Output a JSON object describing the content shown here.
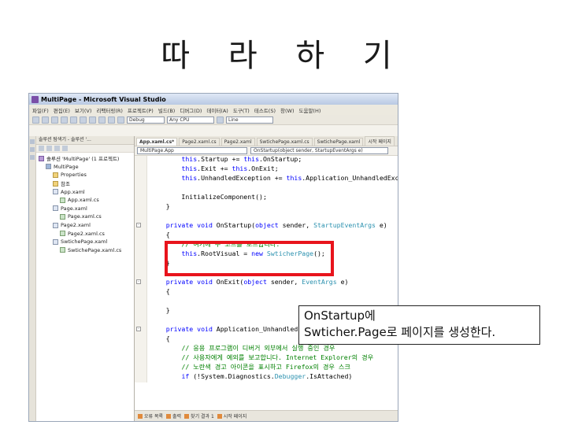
{
  "slide": {
    "title": "따 라 하 기"
  },
  "window": {
    "title": "MultiPage - Microsoft Visual Studio",
    "menu": [
      "파일(F)",
      "편집(E)",
      "보기(V)",
      "리팩터링(R)",
      "프로젝트(P)",
      "빌드(B)",
      "디버그(D)",
      "데이터(A)",
      "도구(T)",
      "테스트(S)",
      "창(W)",
      "도움말(H)"
    ],
    "toolbar": {
      "config": "Debug",
      "platform": "Any CPU",
      "find": "Line"
    }
  },
  "solution_explorer": {
    "header": "솔루션 탐색기 - 솔루션 '...",
    "items": [
      {
        "label": "솔루션 'MultiPage' (1 프로젝트)",
        "icon": "solution-icon",
        "indent": 0
      },
      {
        "label": "MultiPage",
        "icon": "project-icon",
        "indent": 1
      },
      {
        "label": "Properties",
        "icon": "folder-icon",
        "indent": 2
      },
      {
        "label": "참조",
        "icon": "folder-icon",
        "indent": 2
      },
      {
        "label": "App.xaml",
        "icon": "xaml-icon",
        "indent": 2
      },
      {
        "label": "App.xaml.cs",
        "icon": "cs-icon",
        "indent": 3
      },
      {
        "label": "Page.xaml",
        "icon": "xaml-icon",
        "indent": 2
      },
      {
        "label": "Page.xaml.cs",
        "icon": "cs-icon",
        "indent": 3
      },
      {
        "label": "Page2.xaml",
        "icon": "xaml-icon",
        "indent": 2
      },
      {
        "label": "Page2.xaml.cs",
        "icon": "cs-icon",
        "indent": 3
      },
      {
        "label": "SwtichePage.xaml",
        "icon": "xaml-icon",
        "indent": 2
      },
      {
        "label": "SwtichePage.xaml.cs",
        "icon": "cs-icon",
        "indent": 3
      }
    ]
  },
  "editor": {
    "tabs": [
      {
        "label": "App.xaml.cs*",
        "active": true
      },
      {
        "label": "Page2.xaml.cs",
        "active": false
      },
      {
        "label": "Page2.xaml",
        "active": false
      },
      {
        "label": "SwtichePage.xaml.cs",
        "active": false
      },
      {
        "label": "SwtichePage.xaml",
        "active": false
      },
      {
        "label": "시작 페이지",
        "active": false
      }
    ],
    "nav_left": "MultiPage.App",
    "nav_right": "OnStartup(object sender, StartupEventArgs e)",
    "code_lines": [
      {
        "fold": "",
        "segments": [
          {
            "t": "        ",
            "c": ""
          },
          {
            "t": "this",
            "c": "kw"
          },
          {
            "t": ".Startup += ",
            "c": ""
          },
          {
            "t": "this",
            "c": "kw"
          },
          {
            "t": ".OnStartup;",
            "c": ""
          }
        ]
      },
      {
        "fold": "",
        "segments": [
          {
            "t": "        ",
            "c": ""
          },
          {
            "t": "this",
            "c": "kw"
          },
          {
            "t": ".Exit += ",
            "c": ""
          },
          {
            "t": "this",
            "c": "kw"
          },
          {
            "t": ".OnExit;",
            "c": ""
          }
        ]
      },
      {
        "fold": "",
        "segments": [
          {
            "t": "        ",
            "c": ""
          },
          {
            "t": "this",
            "c": "kw"
          },
          {
            "t": ".UnhandledException += ",
            "c": ""
          },
          {
            "t": "this",
            "c": "kw"
          },
          {
            "t": ".Application_UnhandledException;",
            "c": ""
          }
        ]
      },
      {
        "fold": "",
        "segments": [
          {
            "t": "",
            "c": ""
          }
        ]
      },
      {
        "fold": "",
        "segments": [
          {
            "t": "        InitializeComponent();",
            "c": ""
          }
        ]
      },
      {
        "fold": "",
        "segments": [
          {
            "t": "    }",
            "c": ""
          }
        ]
      },
      {
        "fold": "",
        "segments": [
          {
            "t": "",
            "c": ""
          }
        ]
      },
      {
        "fold": "-",
        "segments": [
          {
            "t": "    ",
            "c": ""
          },
          {
            "t": "private void",
            "c": "kw"
          },
          {
            "t": " OnStartup(",
            "c": ""
          },
          {
            "t": "object",
            "c": "kw"
          },
          {
            "t": " sender, ",
            "c": ""
          },
          {
            "t": "StartupEventArgs",
            "c": "ty"
          },
          {
            "t": " e)",
            "c": ""
          }
        ]
      },
      {
        "fold": "",
        "segments": [
          {
            "t": "    {",
            "c": ""
          }
        ]
      },
      {
        "fold": "",
        "segments": [
          {
            "t": "        ",
            "c": ""
          },
          {
            "t": "// 여기에 주 코드를 로드합니다.",
            "c": "cm"
          }
        ]
      },
      {
        "fold": "",
        "segments": [
          {
            "t": "        ",
            "c": ""
          },
          {
            "t": "this",
            "c": "kw"
          },
          {
            "t": ".RootVisual = ",
            "c": ""
          },
          {
            "t": "new",
            "c": "kw"
          },
          {
            "t": " ",
            "c": ""
          },
          {
            "t": "SwticherPage",
            "c": "ty"
          },
          {
            "t": "();",
            "c": ""
          }
        ]
      },
      {
        "fold": "",
        "segments": [
          {
            "t": "    }",
            "c": ""
          }
        ]
      },
      {
        "fold": "",
        "segments": [
          {
            "t": "",
            "c": ""
          }
        ]
      },
      {
        "fold": "-",
        "segments": [
          {
            "t": "    ",
            "c": ""
          },
          {
            "t": "private void",
            "c": "kw"
          },
          {
            "t": " OnExit(",
            "c": ""
          },
          {
            "t": "object",
            "c": "kw"
          },
          {
            "t": " sender, ",
            "c": ""
          },
          {
            "t": "EventArgs",
            "c": "ty"
          },
          {
            "t": " e)",
            "c": ""
          }
        ]
      },
      {
        "fold": "",
        "segments": [
          {
            "t": "    {",
            "c": ""
          }
        ]
      },
      {
        "fold": "",
        "segments": [
          {
            "t": "",
            "c": ""
          }
        ]
      },
      {
        "fold": "",
        "segments": [
          {
            "t": "    }",
            "c": ""
          }
        ]
      },
      {
        "fold": "",
        "segments": [
          {
            "t": "",
            "c": ""
          }
        ]
      },
      {
        "fold": "-",
        "segments": [
          {
            "t": "    ",
            "c": ""
          },
          {
            "t": "private void",
            "c": "kw"
          },
          {
            "t": " Application_UnhandledExce",
            "c": ""
          }
        ]
      },
      {
        "fold": "",
        "segments": [
          {
            "t": "    {",
            "c": ""
          }
        ]
      },
      {
        "fold": "",
        "segments": [
          {
            "t": "        ",
            "c": ""
          },
          {
            "t": "// 응용 프로그램이 디버거 외부에서 실행 중인 경우",
            "c": "cm"
          }
        ]
      },
      {
        "fold": "",
        "segments": [
          {
            "t": "        ",
            "c": ""
          },
          {
            "t": "// 사용자에게 예외를 보고합니다. Internet Explorer의 경우",
            "c": "cm"
          }
        ]
      },
      {
        "fold": "",
        "segments": [
          {
            "t": "        ",
            "c": ""
          },
          {
            "t": "// 노란색 경고 아이콘을 표시하고 Firefox의 경우 스크",
            "c": "cm"
          }
        ]
      },
      {
        "fold": "",
        "segments": [
          {
            "t": "        ",
            "c": ""
          },
          {
            "t": "if",
            "c": "kw"
          },
          {
            "t": " (!System.Diagnostics.",
            "c": ""
          },
          {
            "t": "Debugger",
            "c": "ty"
          },
          {
            "t": ".IsAttached)",
            "c": ""
          }
        ]
      },
      {
        "fold": "",
        "segments": [
          {
            "t": "        {",
            "c": ""
          }
        ]
      }
    ],
    "bottom_tabs": [
      "오류 목록",
      "출력",
      "찾기 결과 1",
      "시작 페이지"
    ]
  },
  "callout": {
    "line1": "OnStartup에",
    "line2": "Swticher.Page로 페이지를 생성한다."
  },
  "colors": {
    "highlight": "#e8141c",
    "keyword": "#0000ff",
    "type": "#2b91af",
    "comment": "#008000"
  }
}
